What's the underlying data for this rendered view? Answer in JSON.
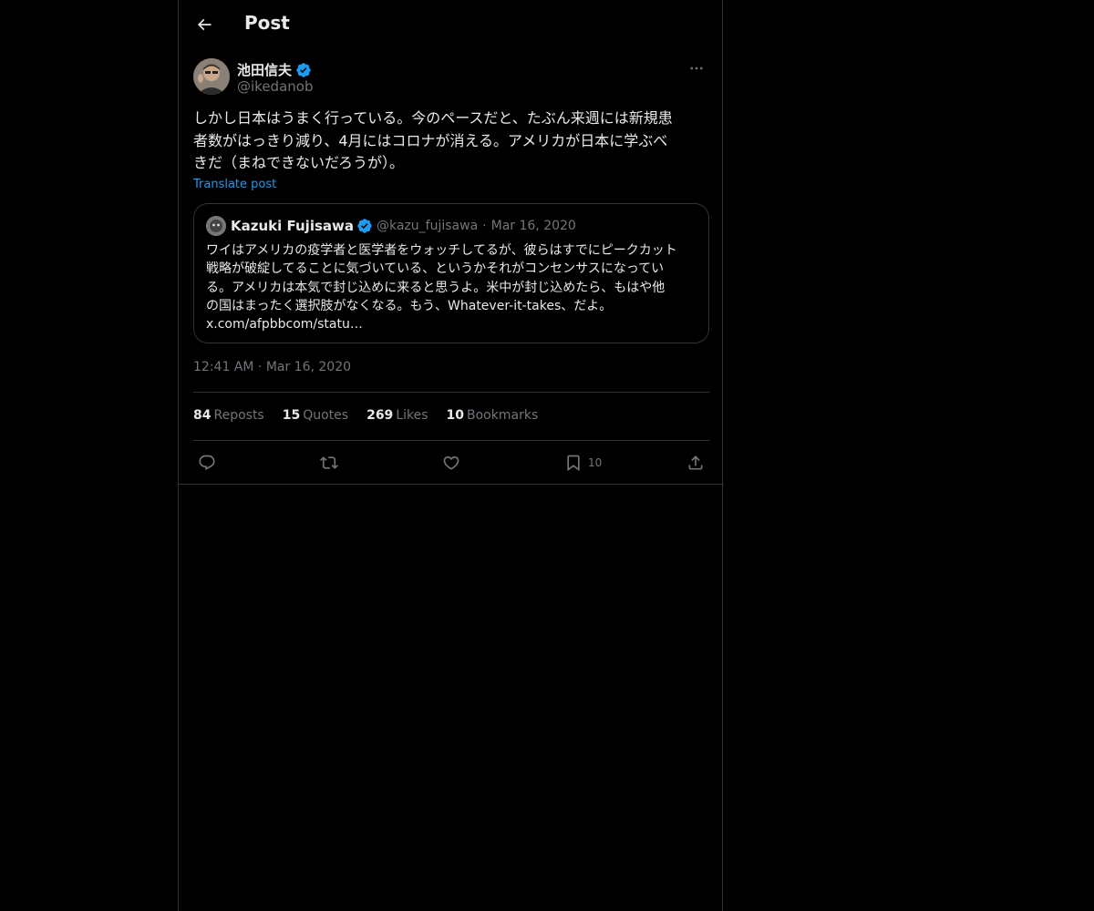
{
  "header": {
    "title": "Post"
  },
  "author": {
    "name": "池田信夫",
    "handle": "@ikedanob"
  },
  "post": {
    "lines": [
      "しかし日本はうまく行っている。今のペースだと、たぶん来週には新規患",
      "者数がはっきり減り、4月にはコロナが消える。アメリカが日本に学ぶべ",
      "きだ（まねできないだろうが）。"
    ],
    "translate_label": "Translate post"
  },
  "quote": {
    "name": "Kazuki Fujisawa",
    "handle": "@kazu_fujisawa",
    "separator": "·",
    "date": "Mar 16, 2020",
    "lines": [
      "ワイはアメリカの疫学者と医学者をウォッチしてるが、彼らはすでにピークカット",
      "戦略が破綻してることに気づいている、というかそれがコンセンサスになってい",
      "る。アメリカは本気で封じ込めに来ると思うよ。米中が封じ込めたら、もはや他",
      "の国はまったく選択肢がなくなる。もう、Whatever-it-takes、だよ。",
      "x.com/afpbbcom/statu…"
    ]
  },
  "timestamp": {
    "time": "12:41 AM",
    "separator": "·",
    "date": "Mar 16, 2020"
  },
  "stats": [
    {
      "count": "84",
      "label": "Reposts"
    },
    {
      "count": "15",
      "label": "Quotes"
    },
    {
      "count": "269",
      "label": "Likes"
    },
    {
      "count": "10",
      "label": "Bookmarks"
    }
  ],
  "actions": {
    "bookmark_count": "10"
  },
  "colors": {
    "accent": "#1d9bf0",
    "background": "#000000",
    "text": "#e7e9ea",
    "muted": "#71767b",
    "border": "#2f3336"
  },
  "icons": [
    "back-arrow-icon",
    "verified-badge-icon",
    "more-icon",
    "reply-icon",
    "repost-icon",
    "like-icon",
    "bookmark-icon",
    "share-icon"
  ]
}
